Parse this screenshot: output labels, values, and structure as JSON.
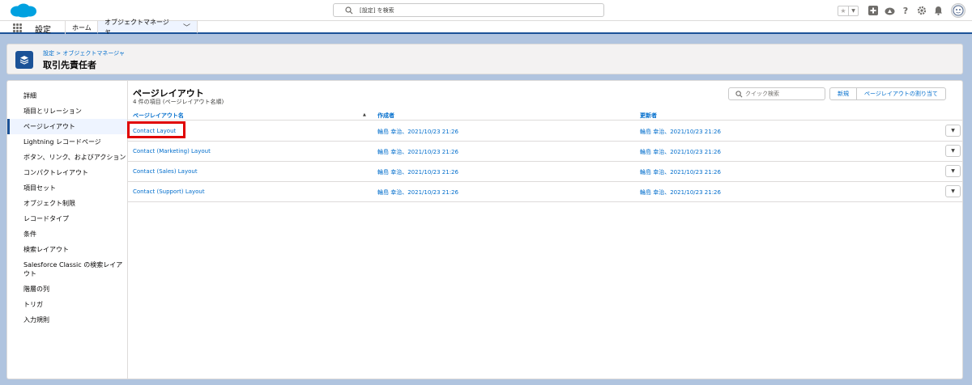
{
  "global_header": {
    "search_placeholder": "[設定] を検索"
  },
  "context_bar": {
    "app_name": "設定",
    "tabs": [
      {
        "label": "ホーム"
      },
      {
        "label": "オブジェクトマネージャ"
      }
    ]
  },
  "page_header": {
    "breadcrumb": "設定 > オブジェクトマネージャ",
    "title": "取引先責任者"
  },
  "sidebar": {
    "items": [
      {
        "label": "詳細"
      },
      {
        "label": "項目とリレーション"
      },
      {
        "label": "ページレイアウト",
        "active": true
      },
      {
        "label": "Lightning レコードページ"
      },
      {
        "label": "ボタン、リンク、およびアクション"
      },
      {
        "label": "コンパクトレイアウト"
      },
      {
        "label": "項目セット"
      },
      {
        "label": "オブジェクト制限"
      },
      {
        "label": "レコードタイプ"
      },
      {
        "label": "条件"
      },
      {
        "label": "検索レイアウト"
      },
      {
        "label": "Salesforce Classic の検索レイアウト"
      },
      {
        "label": "階層の列"
      },
      {
        "label": "トリガ"
      },
      {
        "label": "入力規則"
      }
    ]
  },
  "content": {
    "title": "ページレイアウト",
    "subtitle": "4 件の項目 (ページレイアウト名順)",
    "quick_search_placeholder": "クイック検索",
    "buttons": {
      "new": "新規",
      "assign": "ページレイアウトの割り当て"
    },
    "table": {
      "columns": [
        "ページレイアウト名",
        "作成者",
        "更新者"
      ],
      "rows": [
        {
          "name": "Contact Layout",
          "created": "輪島 幸治、2021/10/23 21:26",
          "modified": "輪島 幸治、2021/10/23 21:26"
        },
        {
          "name": "Contact (Marketing) Layout",
          "created": "輪島 幸治、2021/10/23 21:26",
          "modified": "輪島 幸治、2021/10/23 21:26"
        },
        {
          "name": "Contact (Sales) Layout",
          "created": "輪島 幸治、2021/10/23 21:26",
          "modified": "輪島 幸治、2021/10/23 21:26"
        },
        {
          "name": "Contact (Support) Layout",
          "created": "輪島 幸治、2021/10/23 21:26",
          "modified": "輪島 幸治、2021/10/23 21:26"
        }
      ]
    }
  },
  "icons": {
    "logo": "salesforce-cloud-icon",
    "header": [
      "favorite-star-icon",
      "favorites-list-icon",
      "global-add-icon",
      "trailhead-icon",
      "help-icon",
      "setup-gear-icon",
      "notification-bell-icon",
      "user-avatar-icon"
    ],
    "object": "layers-icon"
  },
  "colors": {
    "brand": "#1b5297",
    "link": "#006dcc",
    "highlight": "#e00000",
    "background": "#b0c4df"
  }
}
